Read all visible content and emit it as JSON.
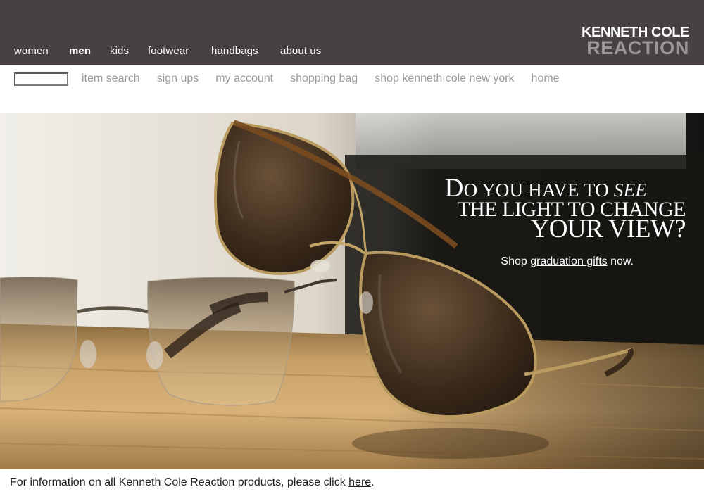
{
  "header": {
    "nav": [
      {
        "label": "women",
        "active": false
      },
      {
        "label": "men",
        "active": true
      },
      {
        "label": "kids",
        "active": false
      },
      {
        "label": "footwear",
        "active": false
      },
      {
        "label": "handbags",
        "active": false
      },
      {
        "label": "about us",
        "active": false
      }
    ],
    "brand": {
      "line1": "KENNETH COLE",
      "line2": "REACTION"
    },
    "colors": {
      "bar": "#474141",
      "brand_secondary": "#9b9797"
    }
  },
  "subnav": {
    "search_value": "",
    "links": [
      "item search",
      "sign ups",
      "my account",
      "shopping bag",
      "shop kenneth cole new york",
      "home"
    ],
    "link_color": "#9a9a9a"
  },
  "hero": {
    "headline_line1_first_letter": "D",
    "headline_line1_rest": "o you have to ",
    "headline_line1_emphasis": "see",
    "headline_line2": "the light to change",
    "headline_line3": "your view?",
    "shop_prefix": "Shop ",
    "shop_link": "graduation gifts",
    "shop_suffix": " now."
  },
  "footer": {
    "text": "For information on all Kenneth Cole Reaction products, please click ",
    "link": "here",
    "suffix": "."
  }
}
